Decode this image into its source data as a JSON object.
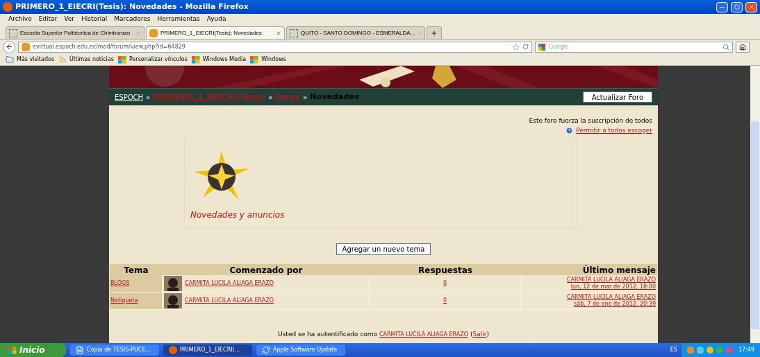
{
  "window": {
    "title": "PRIMERO_1_EIECRI(Tesis): Novedades - Mozilla Firefox"
  },
  "menu": [
    "Archivo",
    "Editar",
    "Ver",
    "Historial",
    "Marcadores",
    "Herramientas",
    "Ayuda"
  ],
  "tabs": [
    {
      "label": "Escuela Superior Politécnica de Chimborazo",
      "selected": false,
      "kind": "blank"
    },
    {
      "label": "PRIMERO_1_EIECRI(Tesis): Novedades",
      "selected": true,
      "kind": "site"
    },
    {
      "label": "QUITO - SANTO DOMINGO - ESMERALDA...",
      "selected": false,
      "kind": "blank"
    }
  ],
  "address": {
    "value": "evirtual.espoch.edu.ec/mod/forum/view.php?id=64829"
  },
  "search": {
    "placeholder": "Google"
  },
  "bookmarks": [
    {
      "label": "Más visitados",
      "kind": "folder"
    },
    {
      "label": "Últimas noticias",
      "kind": "feed"
    },
    {
      "label": "Personalizar vínculos",
      "kind": "windows"
    },
    {
      "label": "Windows Media",
      "kind": "windows"
    },
    {
      "label": "Windows",
      "kind": "windows"
    }
  ],
  "breadcrumb": {
    "separator": "»",
    "items": [
      {
        "label": "ESPOCH",
        "kind": "home"
      },
      {
        "label": "PRIMERO_1_EIECRI(Tesis)",
        "kind": "link"
      },
      {
        "label": "Foros",
        "kind": "link"
      },
      {
        "label": "Novedades",
        "kind": "current"
      }
    ]
  },
  "refresh_button": "Actualizar Foro",
  "subscription": {
    "text": "Este foro fuerza la suscripción de todos",
    "link": "Permitir a todos escoger"
  },
  "forum_intro": {
    "title": "Novedades y anuncios"
  },
  "add_button": "Agregar un nuevo tema",
  "table": {
    "columns": [
      "Tema",
      "Comenzado por",
      "Respuestas",
      "Último mensaje"
    ],
    "rows": [
      {
        "topic": "BLOGS",
        "author": "CARMITA LUCILA ALIAGA ERAZO",
        "replies": "0",
        "last_author": "CARMITA LUCILA ALIAGA ERAZO",
        "last_date": "lun, 12 de mar de 2012, 18:00"
      },
      {
        "topic": "Netiqueta",
        "author": "CARMITA LUCILA ALIAGA ERAZO",
        "replies": "0",
        "last_author": "CARMITA LUCILA ALIAGA ERAZO",
        "last_date": "sáb, 7 de ene de 2012, 20:39"
      }
    ]
  },
  "footer": {
    "before": "Usted se ha autentificado como",
    "user": "CARMITA LUCILA ALIAGA ERAZO",
    "open": "(",
    "logout": "Salir",
    "close": ")"
  },
  "taskbar": {
    "start": "Inicio",
    "items": [
      {
        "label": "Copia de TESIS-PUCE...",
        "selected": false,
        "kind": "doc"
      },
      {
        "label": "PRIMERO_1_EIECRI(...",
        "selected": true,
        "kind": "firefox"
      },
      {
        "label": "Apple Software Update",
        "selected": false,
        "kind": "update"
      }
    ],
    "language": "ES",
    "time": "17:49"
  }
}
